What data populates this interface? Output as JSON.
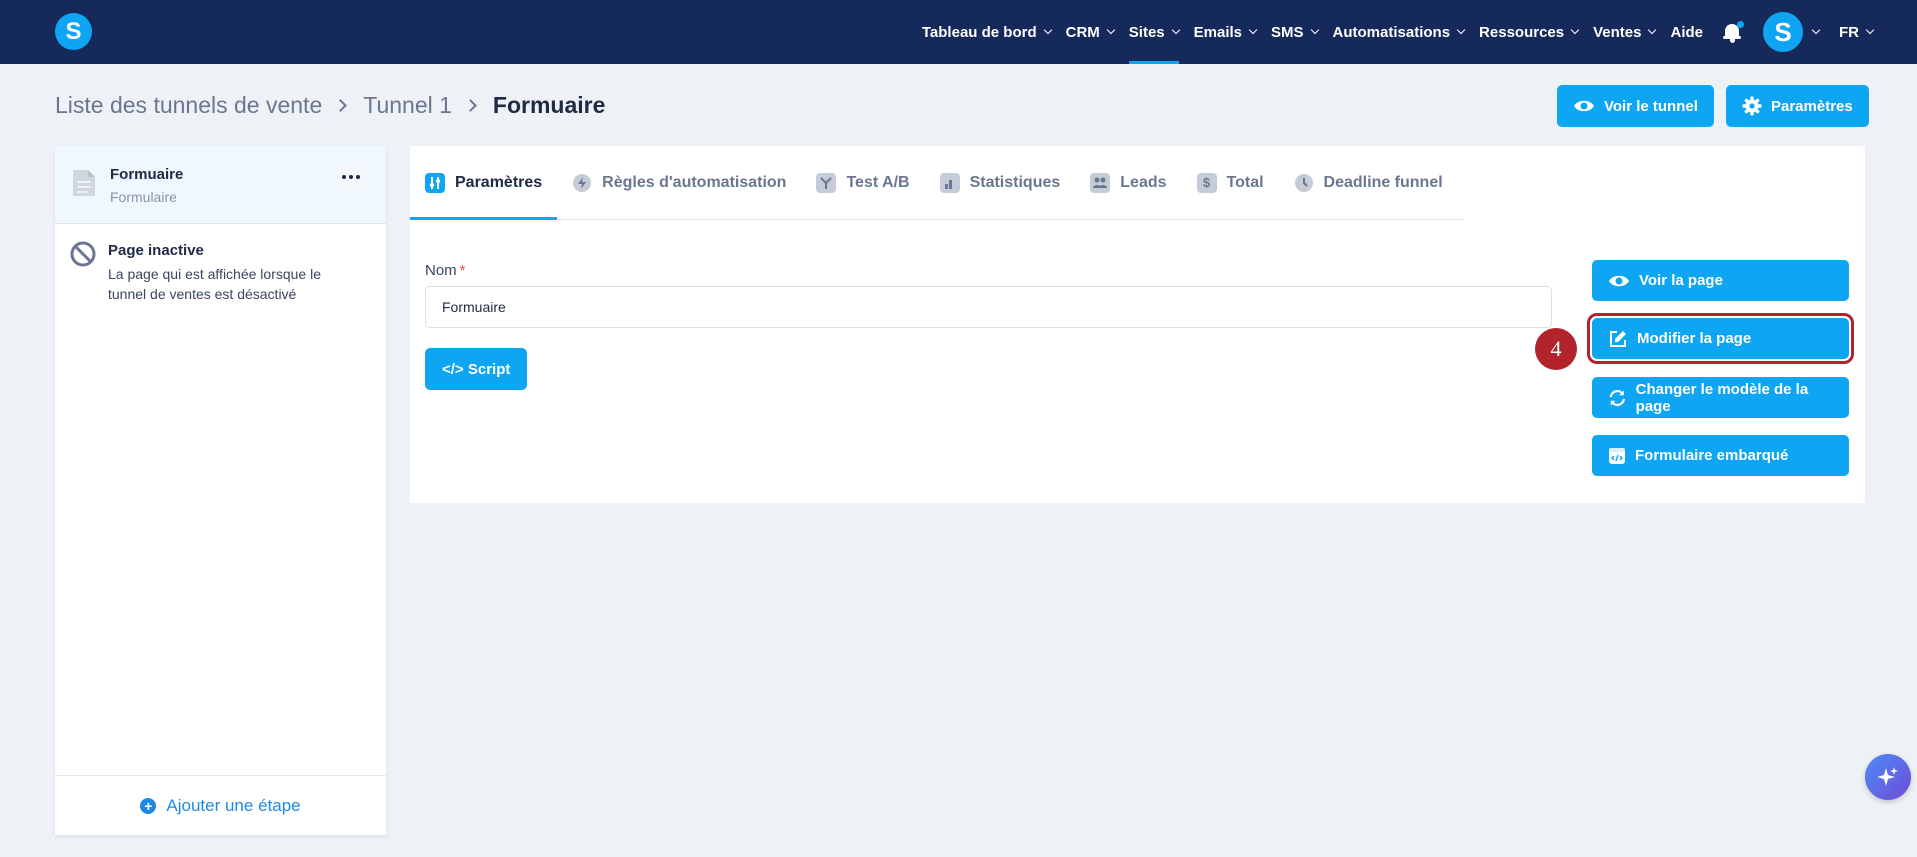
{
  "app": {
    "logo_letter": "S",
    "avatar_letter": "S",
    "accent_color": "#0ea5f3",
    "nav_bg": "#16295b"
  },
  "nav": {
    "items": [
      {
        "label": "Tableau de bord",
        "has_dropdown": true
      },
      {
        "label": "CRM",
        "has_dropdown": true
      },
      {
        "label": "Sites",
        "has_dropdown": true,
        "active": true
      },
      {
        "label": "Emails",
        "has_dropdown": true
      },
      {
        "label": "SMS",
        "has_dropdown": true
      },
      {
        "label": "Automatisations",
        "has_dropdown": true
      },
      {
        "label": "Ressources",
        "has_dropdown": true
      },
      {
        "label": "Ventes",
        "has_dropdown": true
      },
      {
        "label": "Aide",
        "has_dropdown": false
      }
    ],
    "language": "FR"
  },
  "breadcrumb": [
    "Liste des tunnels de vente",
    "Tunnel 1",
    "Formuaire"
  ],
  "header_buttons": {
    "view_tunnel": "Voir le tunnel",
    "settings": "Paramètres"
  },
  "sidebar": {
    "active_step": {
      "title": "Formuaire",
      "subtitle": "Formulaire"
    },
    "inactive_page": {
      "title": "Page inactive",
      "description": "La page qui est affichée lorsque le tunnel de ventes est désactivé"
    },
    "add_step_label": "Ajouter une étape"
  },
  "tabs": [
    {
      "label": "Paramètres",
      "icon": "sliders-icon",
      "active": true
    },
    {
      "label": "Règles d'automatisation",
      "icon": "bolt-icon"
    },
    {
      "label": "Test A/B",
      "icon": "split-icon"
    },
    {
      "label": "Statistiques",
      "icon": "bar-chart-icon"
    },
    {
      "label": "Leads",
      "icon": "users-icon"
    },
    {
      "label": "Total",
      "icon": "dollar-icon"
    },
    {
      "label": "Deadline funnel",
      "icon": "clock-icon"
    }
  ],
  "form": {
    "name_label": "Nom",
    "required_mark": "*",
    "name_value": "Formuaire",
    "script_label": "</> Script"
  },
  "actions": {
    "view_page": "Voir la page",
    "edit_page": "Modifier la page",
    "change_template": "Changer le modèle de la page",
    "embedded_form": "Formulaire embarqué"
  },
  "step_marker": "4"
}
